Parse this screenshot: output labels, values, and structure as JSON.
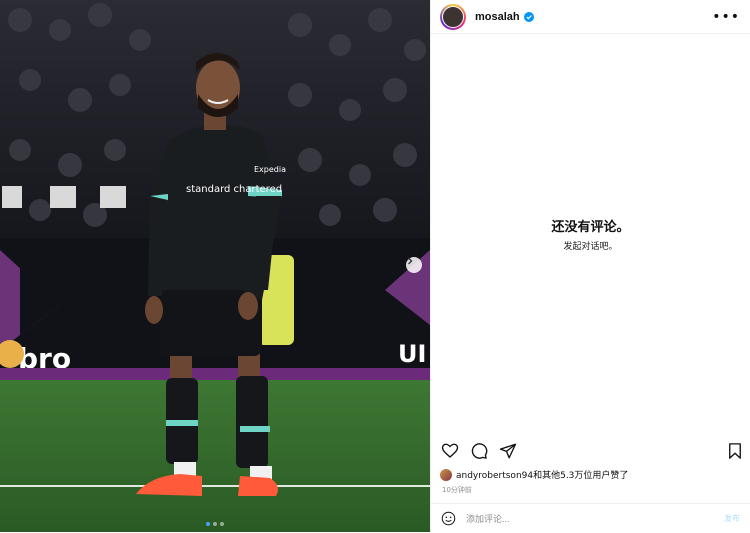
{
  "post": {
    "username": "mosalah",
    "verified": true,
    "more_label": "•••"
  },
  "photo": {
    "caption_shirt_sponsor": "standard chartered",
    "shirt_brand": "Expedia",
    "ad_board_text": "bro",
    "ad_board_text_right": "UI",
    "carousel_total": 3,
    "carousel_active": 1
  },
  "comments": {
    "empty_title": "还没有评论。",
    "empty_subtitle": "发起对话吧。"
  },
  "actions": {
    "icons": [
      "heart-icon",
      "comment-icon",
      "share-icon",
      "bookmark-icon"
    ]
  },
  "likes": {
    "text": "andyrobertson94和其他5.3万位用户赞了"
  },
  "timestamp": "10分钟前",
  "comment_box": {
    "placeholder": "添加评论...",
    "post_label": "发布"
  },
  "colors": {
    "accent": "#0095f6",
    "post_disabled": "#b2dffc",
    "pitch": "#2f6b2a",
    "kit": "#1a1d1f",
    "kit_trim": "#6fd4c5"
  }
}
